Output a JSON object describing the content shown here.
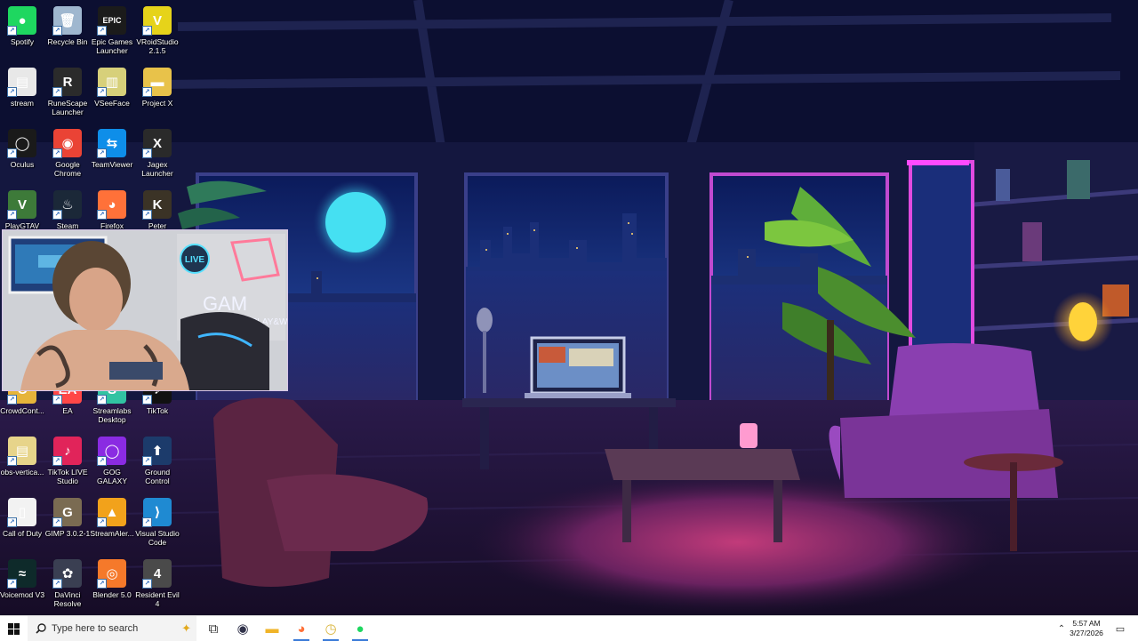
{
  "desktop_icons": [
    {
      "label": "Spotify",
      "glyph": "●",
      "bg": "#1ed760",
      "icon": "spotify-icon"
    },
    {
      "label": "Recycle Bin",
      "glyph": "🗑",
      "bg": "#9fb7cf",
      "icon": "recycle-bin-icon"
    },
    {
      "label": "Epic Games Launcher",
      "glyph": "EPIC",
      "bg": "#1b1b1b",
      "icon": "epic-games-icon"
    },
    {
      "label": "VRoidStudio 2.1.5",
      "glyph": "V",
      "bg": "#e6d31a",
      "icon": "vroid-studio-icon"
    },
    {
      "label": "stream",
      "glyph": "▤",
      "bg": "#e8e8e8",
      "icon": "file-icon"
    },
    {
      "label": "RuneScape Launcher",
      "glyph": "R",
      "bg": "#2b2b2b",
      "icon": "runescape-icon"
    },
    {
      "label": "VSeeFace",
      "glyph": "▥",
      "bg": "#d7d07a",
      "icon": "vseeface-icon"
    },
    {
      "label": "Project X",
      "glyph": "▬",
      "bg": "#e8c24a",
      "icon": "folder-icon"
    },
    {
      "label": "Oculus",
      "glyph": "◯",
      "bg": "#1a1a1a",
      "icon": "oculus-icon"
    },
    {
      "label": "Google Chrome",
      "glyph": "◉",
      "bg": "#ea4335",
      "icon": "chrome-icon"
    },
    {
      "label": "TeamViewer",
      "glyph": "⇆",
      "bg": "#0e8ee9",
      "icon": "teamviewer-icon"
    },
    {
      "label": "Jagex Launcher",
      "glyph": "X",
      "bg": "#2a2a2a",
      "icon": "jagex-icon"
    },
    {
      "label": "PlayGTAV",
      "glyph": "V",
      "bg": "#3d7a39",
      "icon": "gtav-icon"
    },
    {
      "label": "Steam",
      "glyph": "♨",
      "bg": "#1b2838",
      "icon": "steam-icon"
    },
    {
      "label": "Firefox",
      "glyph": "◕",
      "bg": "#ff7139",
      "icon": "firefox-icon"
    },
    {
      "label": "Peter",
      "glyph": "K",
      "bg": "#3b3326",
      "icon": "peter-game-icon"
    },
    {
      "label": "CrowdCont...",
      "glyph": "C",
      "bg": "#e6b43a",
      "icon": "crowdcontrol-icon"
    },
    {
      "label": "EA",
      "glyph": "EA",
      "bg": "#ff4747",
      "icon": "ea-icon"
    },
    {
      "label": "Streamlabs Desktop",
      "glyph": "S",
      "bg": "#31c3a2",
      "icon": "streamlabs-icon"
    },
    {
      "label": "TikTok",
      "glyph": "♪",
      "bg": "#111111",
      "icon": "tiktok-icon"
    },
    {
      "label": "obs-vertica...",
      "glyph": "▤",
      "bg": "#e7d48a",
      "icon": "folder-icon"
    },
    {
      "label": "TikTok LIVE Studio",
      "glyph": "♪",
      "bg": "#e1245a",
      "icon": "tiktok-live-icon"
    },
    {
      "label": "GOG GALAXY",
      "glyph": "◯",
      "bg": "#8a2be2",
      "icon": "gog-galaxy-icon"
    },
    {
      "label": "Ground Control",
      "glyph": "⬆",
      "bg": "#1c3b6b",
      "icon": "ground-control-icon"
    },
    {
      "label": "Call of Duty",
      "glyph": "▯",
      "bg": "#f2f2f2",
      "icon": "file-icon"
    },
    {
      "label": "GIMP 3.0.2-1",
      "glyph": "G",
      "bg": "#7a6b52",
      "icon": "gimp-icon"
    },
    {
      "label": "StreamAler...",
      "glyph": "▲",
      "bg": "#f2a21b",
      "icon": "streamalerts-icon"
    },
    {
      "label": "Visual Studio Code",
      "glyph": "⟩",
      "bg": "#1f8ad2",
      "icon": "vscode-icon"
    },
    {
      "label": "Voicemod V3",
      "glyph": "≈",
      "bg": "#0e2a2a",
      "icon": "voicemod-icon"
    },
    {
      "label": "DaVinci Resolve",
      "glyph": "✿",
      "bg": "#3a3f52",
      "icon": "davinci-resolve-icon"
    },
    {
      "label": "Blender 5.0",
      "glyph": "◎",
      "bg": "#f5792a",
      "icon": "blender-icon"
    },
    {
      "label": "Resident Evil 4",
      "glyph": "4",
      "bg": "#4a4a4a",
      "icon": "resident-evil-icon"
    }
  ],
  "webcam": {
    "sign_top": "LIVE",
    "sign_main": "GAM",
    "sign_sub": "PLAY&W"
  },
  "taskbar": {
    "search_placeholder": "Type here to search",
    "pinned": [
      {
        "name": "task-view-icon",
        "glyph": "⧉",
        "color": "#333333"
      },
      {
        "name": "obs-icon",
        "glyph": "◉",
        "color": "#30324a"
      },
      {
        "name": "file-explorer-icon",
        "glyph": "▬",
        "color": "#f0b429"
      },
      {
        "name": "firefox-taskbar-icon",
        "glyph": "◕",
        "color": "#ff7139"
      },
      {
        "name": "clock-app-icon",
        "glyph": "◷",
        "color": "#d9b43a"
      },
      {
        "name": "spotify-taskbar-icon",
        "glyph": "●",
        "color": "#1ed760"
      }
    ],
    "time": "5:57 AM",
    "date": "3/27/2026"
  }
}
